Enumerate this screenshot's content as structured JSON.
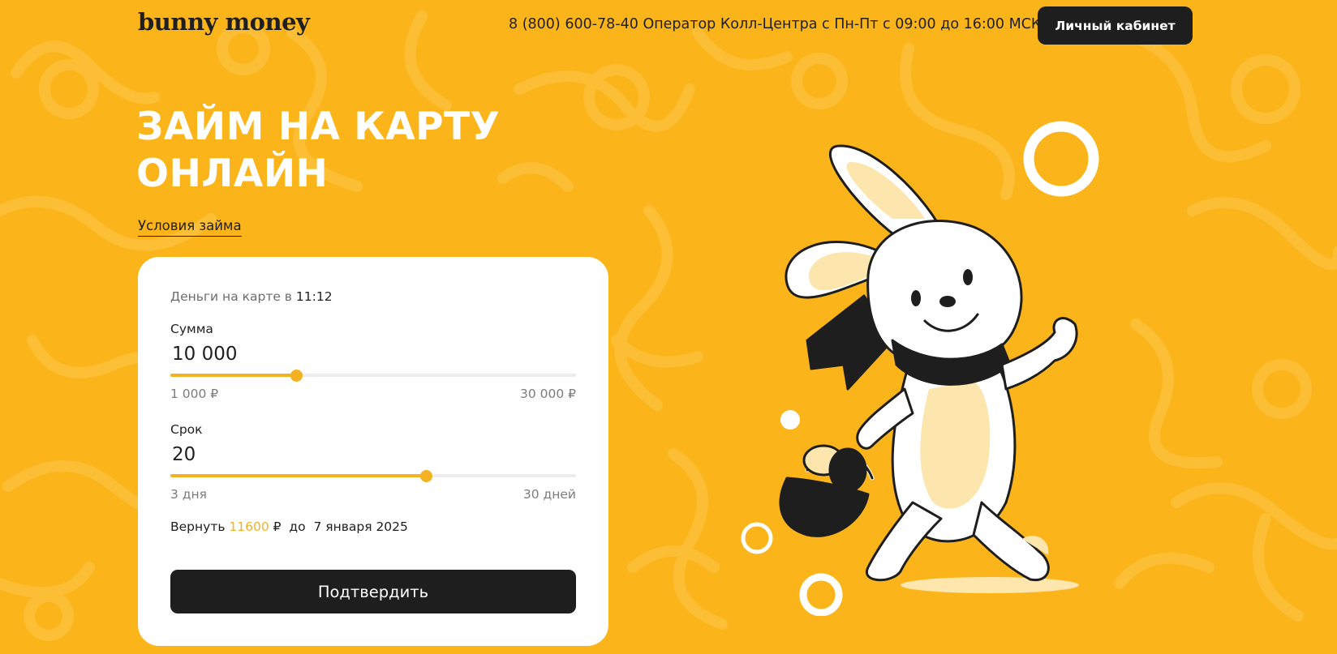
{
  "brand": {
    "logo_text": "bunny money"
  },
  "header": {
    "hotline": "8 (800) 600-78-40 Оператор Колл-Центра с Пн-Пт с 09:00 до 16:00 МСК",
    "cabinet_button": "Личный кабинет"
  },
  "hero": {
    "title_line1": "ЗАЙМ НА КАРТУ",
    "title_line2": "ОНЛАЙН",
    "terms_link": "Условия займа"
  },
  "calculator": {
    "delivery_prefix": "Деньги на карте в",
    "delivery_time": "11:12",
    "amount": {
      "label": "Сумма",
      "value": "10 000",
      "min_label": "1 000 ₽",
      "max_label": "30 000 ₽",
      "level": 0.31
    },
    "term": {
      "label": "Срок",
      "value": "20",
      "min_label": "3 дня",
      "max_label": "30 дней",
      "level": 0.63
    },
    "repay": {
      "prefix": "Вернуть",
      "amount": "11600",
      "currency": "₽",
      "until": "до",
      "date": "7 января 2025"
    },
    "confirm_button": "Подтвердить"
  },
  "colors": {
    "background": "#fbb51b",
    "accent": "#f4b223",
    "dark": "#1e1e1e",
    "card": "#ffffff"
  }
}
